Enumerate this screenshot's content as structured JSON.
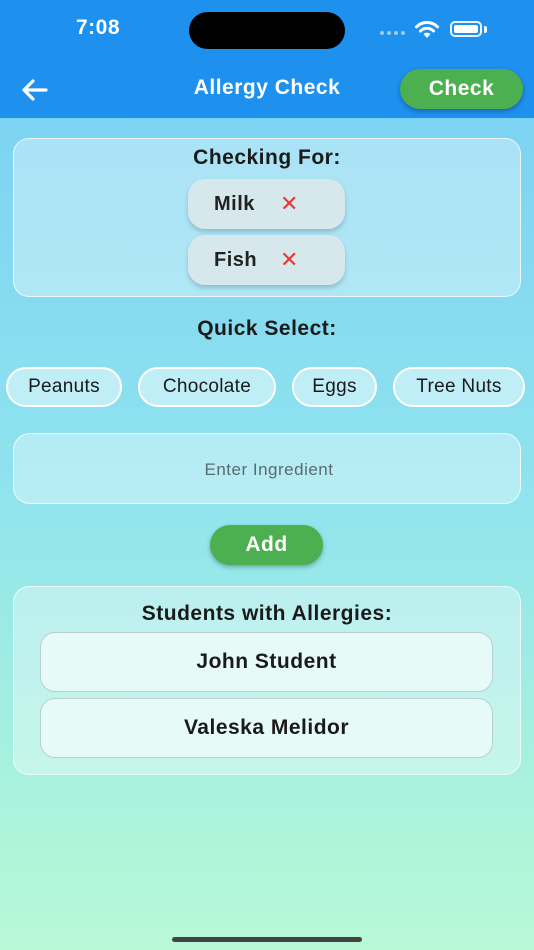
{
  "status": {
    "time": "7:08"
  },
  "nav": {
    "title": "Allergy Check",
    "check_label": "Check"
  },
  "checking": {
    "title": "Checking For:",
    "items": [
      {
        "label": "Milk",
        "remove": "✕"
      },
      {
        "label": "Fish",
        "remove": "✕"
      }
    ]
  },
  "quick_select": {
    "title": "Quick Select:",
    "options": [
      "Peanuts",
      "Chocolate",
      "Eggs",
      "Tree Nuts"
    ]
  },
  "ingredient_input": {
    "placeholder": "Enter Ingredient",
    "value": ""
  },
  "add_label": "Add",
  "students": {
    "title": "Students with Allergies:",
    "items": [
      "John Student",
      "Valeska Melidor"
    ]
  },
  "colors": {
    "header": "#1e90ee",
    "accent_green": "#4caf50",
    "remove_red": "#e53935"
  }
}
